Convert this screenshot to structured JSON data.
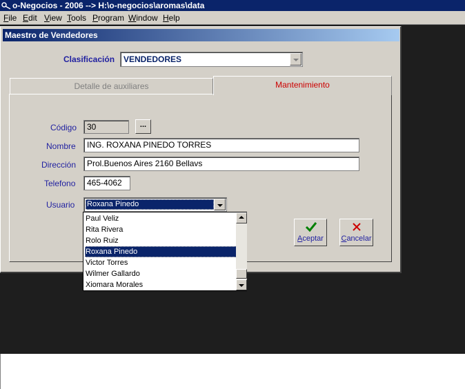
{
  "app": {
    "title": "o-Negocios - 2006 --> H:\\o-negocios\\aromas\\data"
  },
  "menu": [
    {
      "label": "File",
      "mnemonic": "F",
      "rest": "ile"
    },
    {
      "label": "Edit",
      "mnemonic": "E",
      "rest": "dit"
    },
    {
      "label": "View",
      "mnemonic": "V",
      "rest": "iew"
    },
    {
      "label": "Tools",
      "mnemonic": "T",
      "rest": "ools"
    },
    {
      "label": "Program",
      "mnemonic": "P",
      "rest": "rogram"
    },
    {
      "label": "Window",
      "mnemonic": "W",
      "rest": "indow"
    },
    {
      "label": "Help",
      "mnemonic": "H",
      "rest": "elp"
    }
  ],
  "window": {
    "title": "Maestro de Vendedores"
  },
  "clasificacion": {
    "label": "Clasificación",
    "value": "VENDEDORES"
  },
  "tabs": [
    {
      "label": "Detalle de auxiliares",
      "active": false
    },
    {
      "label": "Mantenimiento",
      "active": true
    }
  ],
  "form": {
    "codigo": {
      "label": "Código",
      "value": "30"
    },
    "ellipsis": "...",
    "nombre": {
      "label": "Nombre",
      "value": "ING. ROXANA PINEDO TORRES"
    },
    "direccion": {
      "label": "Dirección",
      "value": "Prol.Buenos Aires 2160 Bellavs"
    },
    "telefono": {
      "label": "Telefono",
      "value": "465-4062"
    },
    "usuario": {
      "label": "Usuario",
      "value": "Roxana Pinedo"
    }
  },
  "dropdown": {
    "options": [
      "Paul Veliz",
      "Rita Rivera",
      "Rolo Ruiz",
      "Roxana Pinedo",
      "Victor  Torres",
      "Wilmer Gallardo",
      "Xiomara Morales"
    ],
    "selected": "Roxana Pinedo"
  },
  "buttons": {
    "aceptar": {
      "label": "Aceptar",
      "mnemonic": "A",
      "rest": "ceptar",
      "icon": "checkmark-icon",
      "color": "#008000"
    },
    "cancelar": {
      "label": "Cancelar",
      "mnemonic": "C",
      "rest": "ancelar",
      "icon": "x-icon",
      "color": "#cc0000"
    }
  },
  "colors": {
    "titlebar": "#0a246a",
    "label_blue": "#1f1fa0",
    "active_tab_red": "#cc0000",
    "selection": "#0a246a"
  }
}
